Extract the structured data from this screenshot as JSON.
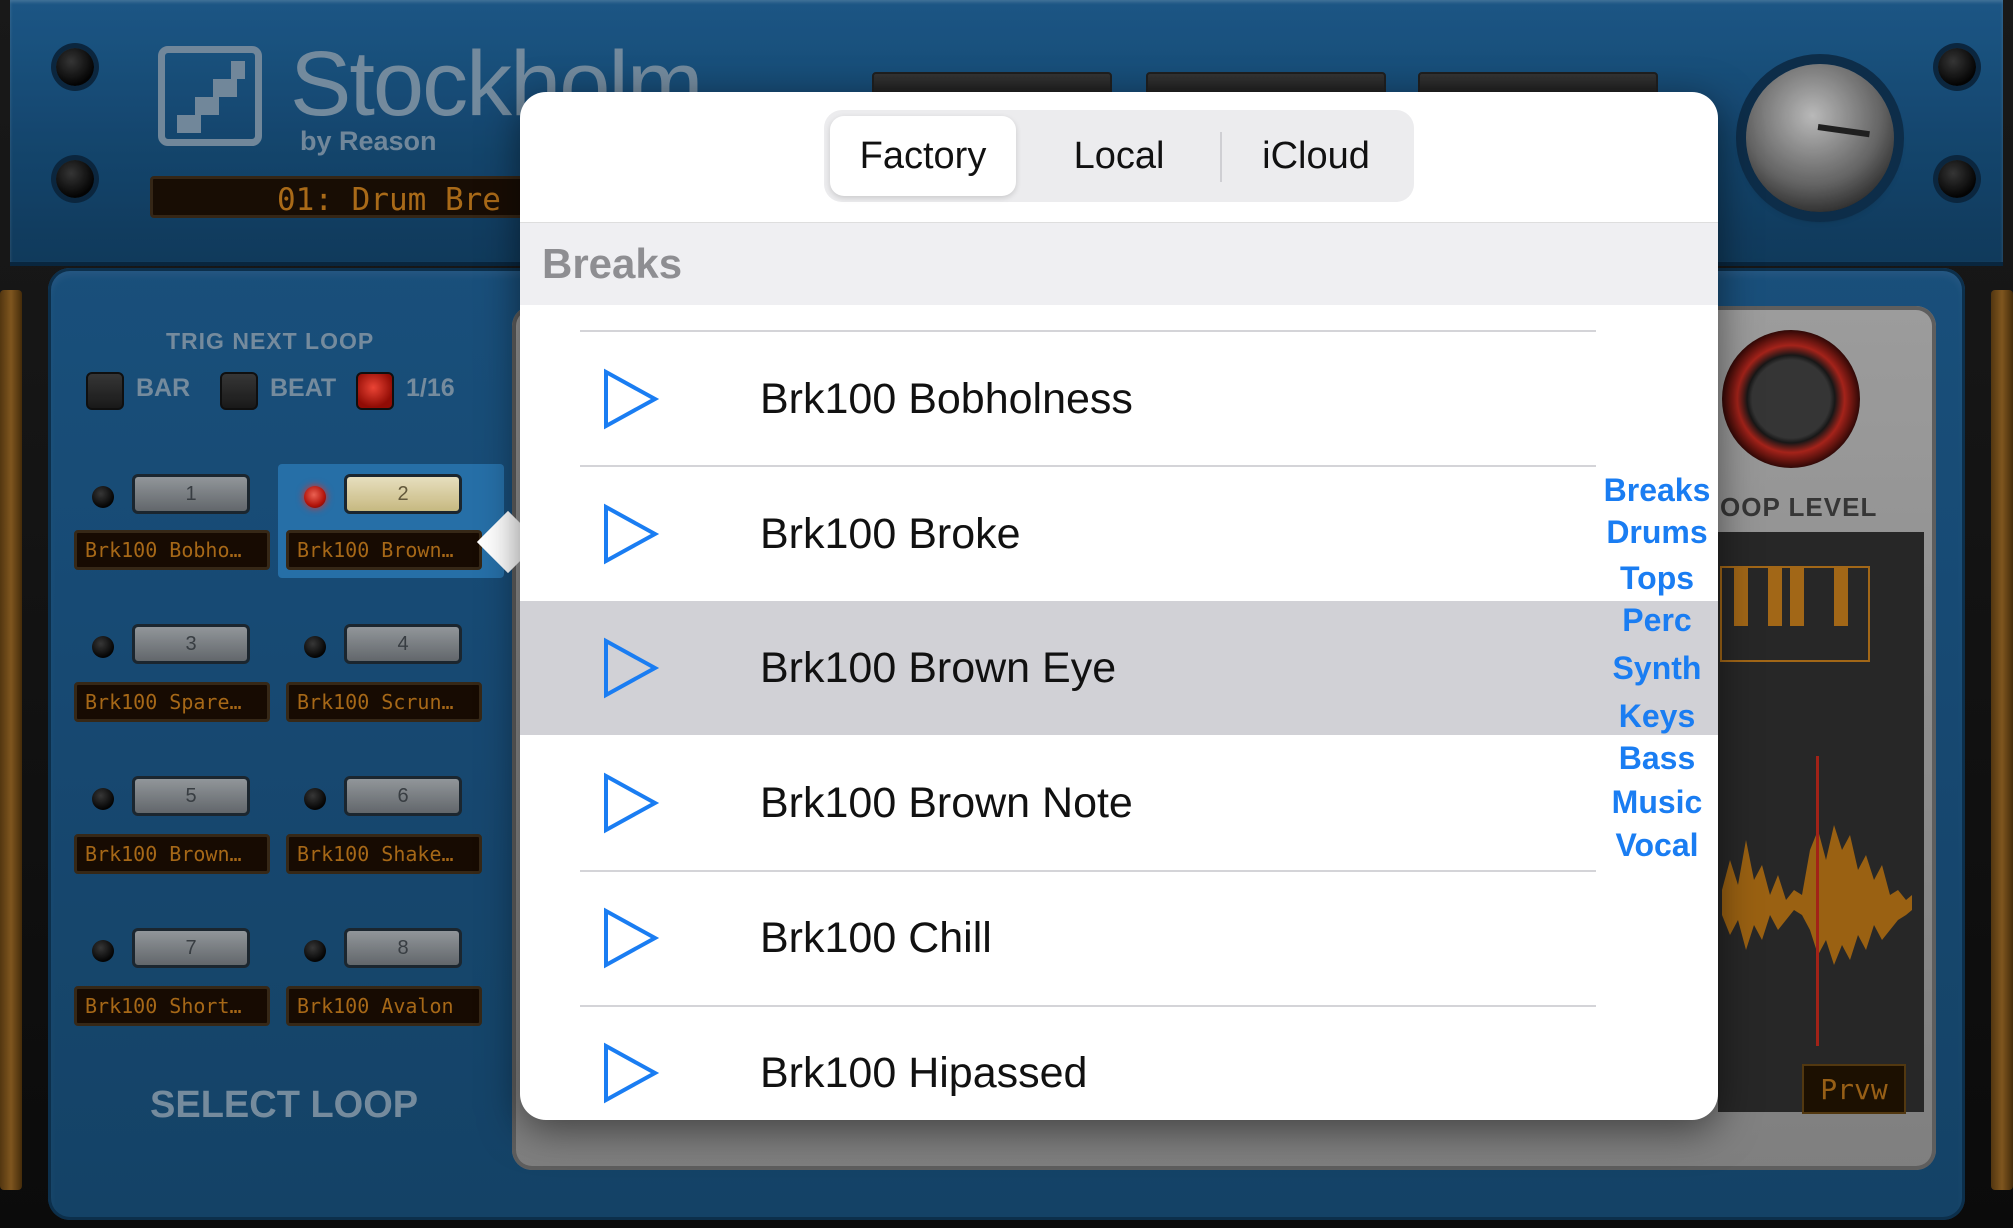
{
  "app": {
    "brand": "Stockholm",
    "by_line": "by Reason",
    "preset_display": "01: Drum Bre"
  },
  "trig": {
    "title": "TRIG NEXT LOOP",
    "options": [
      {
        "label": "BAR",
        "active": false
      },
      {
        "label": "BEAT",
        "active": false
      },
      {
        "label": "1/16",
        "active": true
      }
    ]
  },
  "slots": [
    {
      "number": "1",
      "name": "Brk100 Bobho…",
      "selected": false
    },
    {
      "number": "2",
      "name": "Brk100 Brown…",
      "selected": true
    },
    {
      "number": "3",
      "name": "Brk100 Spare…",
      "selected": false
    },
    {
      "number": "4",
      "name": "Brk100 Scrun…",
      "selected": false
    },
    {
      "number": "5",
      "name": "Brk100 Brown…",
      "selected": false
    },
    {
      "number": "6",
      "name": "Brk100 Shake…",
      "selected": false
    },
    {
      "number": "7",
      "name": "Brk100 Short…",
      "selected": false
    },
    {
      "number": "8",
      "name": "Brk100 Avalon",
      "selected": false
    }
  ],
  "select_loop_label": "SELECT LOOP",
  "loop_level_label": "OOP LEVEL",
  "preview_button": "Prvw",
  "popover": {
    "tabs": [
      "Factory",
      "Local",
      "iCloud"
    ],
    "selected_tab": "Factory",
    "section_header": "Breaks",
    "items": [
      {
        "name": "Brk100 Bobholness",
        "highlighted": false
      },
      {
        "name": "Brk100 Broke",
        "highlighted": false
      },
      {
        "name": "Brk100 Brown Eye",
        "highlighted": true
      },
      {
        "name": "Brk100 Brown Note",
        "highlighted": false
      },
      {
        "name": "Brk100 Chill",
        "highlighted": false
      },
      {
        "name": "Brk100 Hipassed",
        "highlighted": false
      }
    ],
    "index": [
      "Breaks",
      "Drums",
      "Tops",
      "Perc",
      "Synth",
      "Keys",
      "Bass",
      "Music",
      "Vocal"
    ]
  },
  "colors": {
    "accent": "#1a7df2",
    "panel_blue": "#1c5686",
    "display_amber": "#b5711a",
    "highlight_row": "#d1d1d6"
  },
  "icons": {
    "play": "play-triangle-icon",
    "screw": "screw-icon"
  }
}
